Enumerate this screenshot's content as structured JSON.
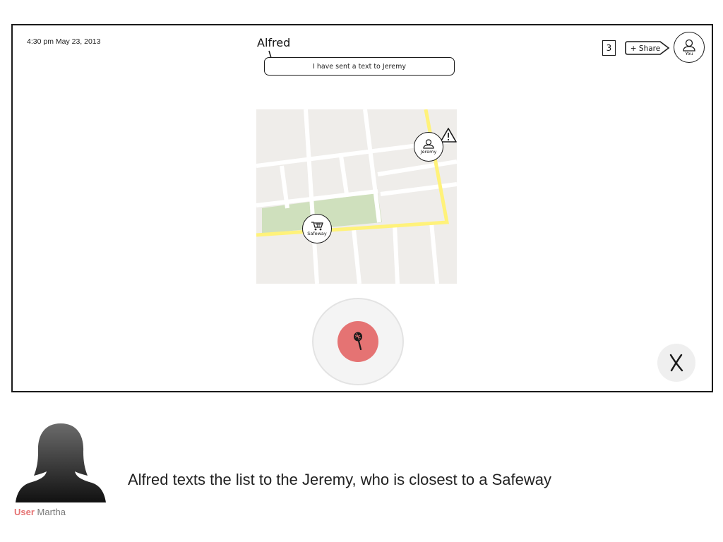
{
  "header": {
    "timestamp": "4:30 pm May 23, 2013",
    "agent_name": "Alfred",
    "message": "I have sent a text to Jeremy",
    "count": "3",
    "share_label": "+ Share",
    "you_label": "You"
  },
  "map": {
    "pins": [
      {
        "label": "Jeremy",
        "icon": "person-icon"
      },
      {
        "label": "Safeway",
        "icon": "cart-icon"
      }
    ],
    "alert_icon": "warning-icon",
    "colors": {
      "land": "#efedea",
      "road": "#ffffff",
      "highway": "#fff27a",
      "park": "#cfe0bd"
    }
  },
  "controls": {
    "record_icon": "microphone-icon",
    "record_color": "#e57373",
    "close_icon": "close-icon"
  },
  "scenario": {
    "user_role": "User",
    "user_name": "Martha",
    "description": "Alfred texts the list to the Jeremy, who is closest to a Safeway"
  }
}
